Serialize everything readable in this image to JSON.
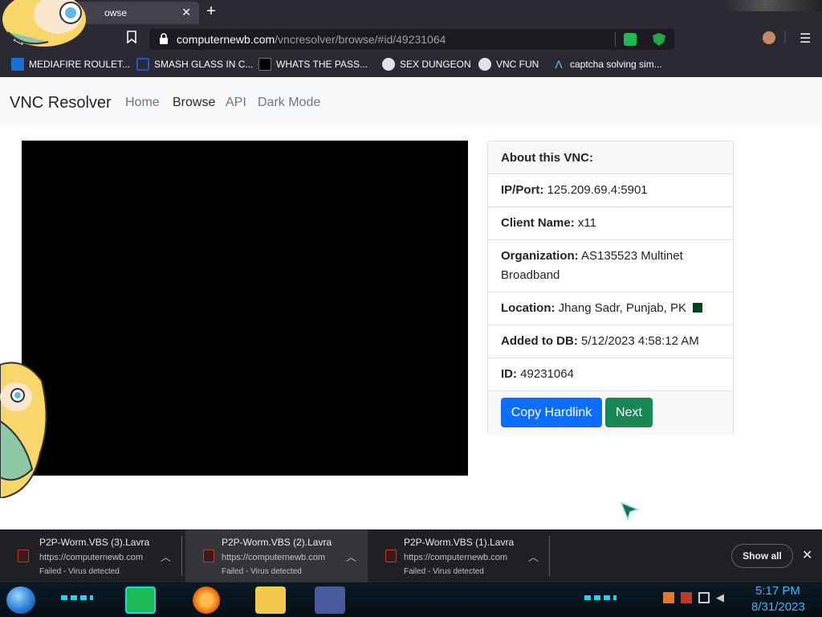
{
  "browser": {
    "tab_title": "owse",
    "url_host": "computernewb.com",
    "url_path": "/vncresolver/browse/#id/49231064",
    "bookmarks": [
      "MEDIAFIRE ROULET...",
      "SMASH GLASS IN C...",
      "WHATS THE PASS...",
      "SEX DUNGEON",
      "VNC FUN",
      "captcha solving sim..."
    ]
  },
  "site": {
    "brand": "VNC Resolver",
    "nav": [
      "Home",
      "Browse",
      "API",
      "Dark Mode"
    ]
  },
  "card": {
    "header": "About this VNC:",
    "ip_label": "IP/Port:",
    "ip_value": "125.209.69.4:5901",
    "client_label": "Client Name:",
    "client_value": "x11",
    "org_label": "Organization:",
    "org_value": "AS135523 Multinet Broadband",
    "location_label": "Location:",
    "location_value": "Jhang Sadr, Punjab, PK",
    "added_label": "Added to DB:",
    "added_value": "5/12/2023 4:58:12 AM",
    "id_label": "ID:",
    "id_value": "49231064",
    "copy_button": "Copy Hardlink",
    "next_button": "Next"
  },
  "downloads": {
    "items": [
      {
        "name": "P2P-Worm.VBS (3).Lavra",
        "source": "https://computernewb.com",
        "status": "Failed - Virus detected"
      },
      {
        "name": "P2P-Worm.VBS (2).Lavra",
        "source": "https://computernewb.com",
        "status": "Failed - Virus detected"
      },
      {
        "name": "P2P-Worm.VBS (1).Lavra",
        "source": "https://computernewb.com",
        "status": "Failed - Virus detected"
      }
    ],
    "show_all": "Show all"
  },
  "taskbar": {
    "time": "5:17 PM",
    "date": "8/31/2023"
  },
  "colors": {
    "primary": "#0d6efd",
    "success": "#198754",
    "clock": "#3fb5ff"
  }
}
